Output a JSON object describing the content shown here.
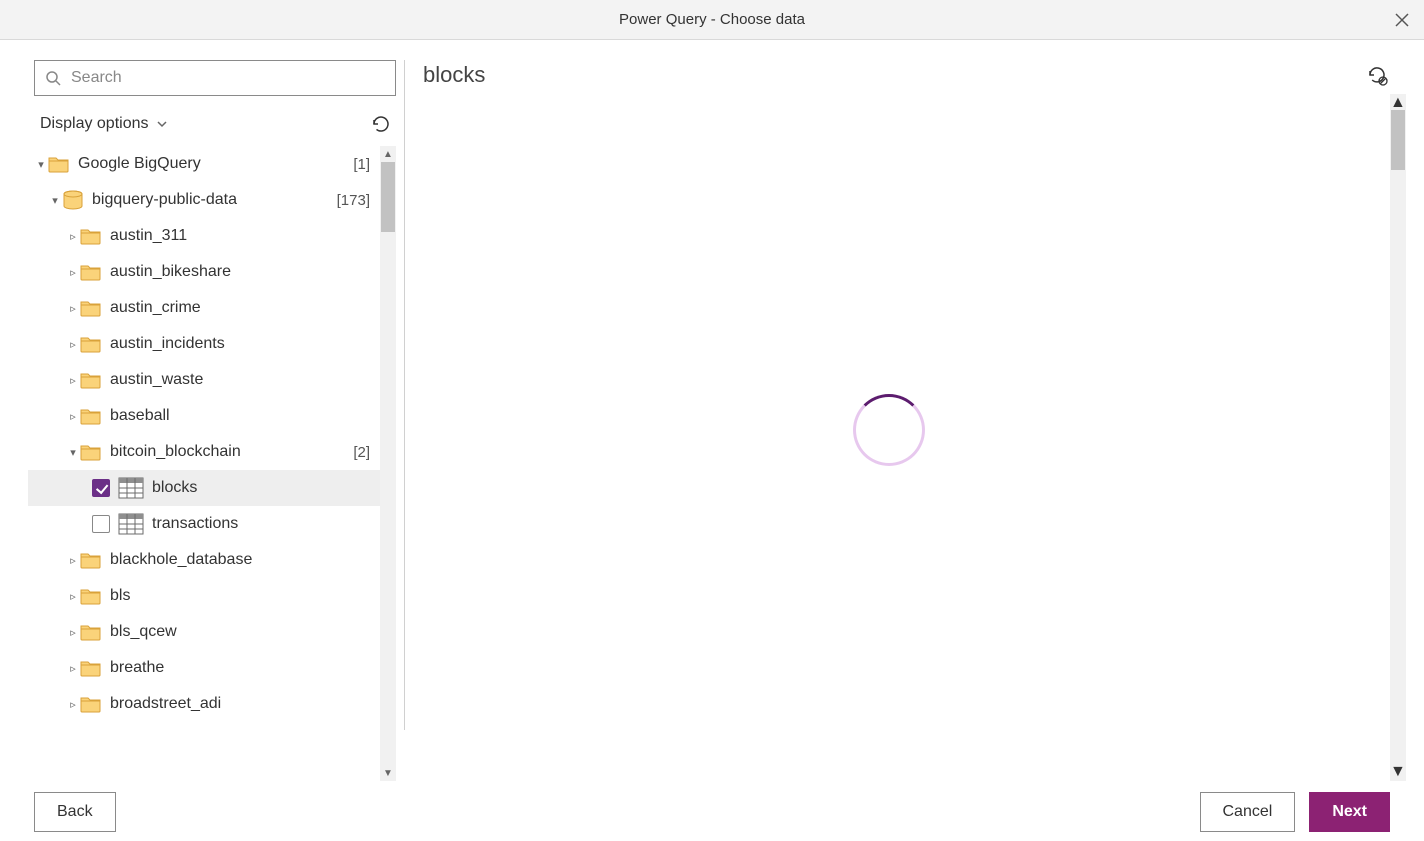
{
  "window": {
    "title": "Power Query - Choose data"
  },
  "search": {
    "placeholder": "Search"
  },
  "displayOptions": {
    "label": "Display options"
  },
  "tree": {
    "root": {
      "label": "Google BigQuery",
      "count": "[1]"
    },
    "db": {
      "label": "bigquery-public-data",
      "count": "[173]"
    },
    "datasets": [
      {
        "label": "austin_311"
      },
      {
        "label": "austin_bikeshare"
      },
      {
        "label": "austin_crime"
      },
      {
        "label": "austin_incidents"
      },
      {
        "label": "austin_waste"
      },
      {
        "label": "baseball"
      }
    ],
    "expanded": {
      "label": "bitcoin_blockchain",
      "count": "[2]"
    },
    "tables": [
      {
        "label": "blocks",
        "checked": true
      },
      {
        "label": "transactions",
        "checked": false
      }
    ],
    "tail": [
      {
        "label": "blackhole_database"
      },
      {
        "label": "bls"
      },
      {
        "label": "bls_qcew"
      },
      {
        "label": "breathe"
      },
      {
        "label": "broadstreet_adi"
      }
    ]
  },
  "preview": {
    "title": "blocks"
  },
  "footer": {
    "back": "Back",
    "cancel": "Cancel",
    "next": "Next"
  }
}
